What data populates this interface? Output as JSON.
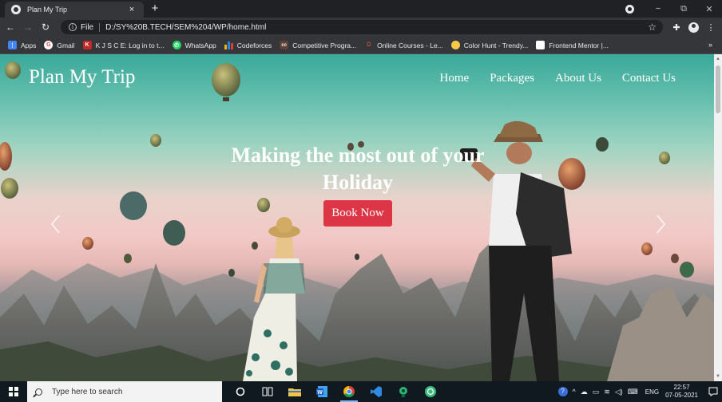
{
  "browser": {
    "tab": {
      "title": "Plan My Trip",
      "close_glyph": "×"
    },
    "new_tab_glyph": "+",
    "window_controls": {
      "minimize": "−",
      "restore": "⧉",
      "close": "✕"
    },
    "omnibox": {
      "scheme": "File",
      "url": "D:/SY%20B.TECH/SEM%204/WP/home.html"
    },
    "bookmarks": [
      {
        "label": "Apps",
        "icon": "apps-grid-icon",
        "color": "#4285f4"
      },
      {
        "label": "Gmail",
        "icon": "google-icon",
        "color": "#ea4335"
      },
      {
        "label": "K J S C E: Log in to t...",
        "icon": "kjsce-icon",
        "color": "#c62828"
      },
      {
        "label": "WhatsApp",
        "icon": "whatsapp-icon",
        "color": "#25d366"
      },
      {
        "label": "Codeforces",
        "icon": "codeforces-icon",
        "color": "#f2b200"
      },
      {
        "label": "Competitive Progra...",
        "icon": "cc-icon",
        "color": "#5d4037"
      },
      {
        "label": "Online Courses - Le...",
        "icon": "udemy-icon",
        "color": "#ec5252"
      },
      {
        "label": "Color Hunt - Trendy...",
        "icon": "colorhunt-icon",
        "color": "#f7c948"
      },
      {
        "label": "Frontend Mentor |...",
        "icon": "frontend-mentor-icon",
        "color": "#ffffff"
      }
    ],
    "bookmarks_more": "»"
  },
  "page": {
    "brand": "Plan My Trip",
    "nav": [
      "Home",
      "Packages",
      "About Us",
      "Contact Us"
    ],
    "hero_title": "Making the most out of your Holiday",
    "cta_label": "Book Now",
    "colors": {
      "cta": "#dc3545",
      "sky_top": "#3aa99a",
      "sky_mid": "#f2c8c6"
    }
  },
  "taskbar": {
    "search_placeholder": "Type here to search",
    "apps": [
      "cortana-icon",
      "task-view-icon",
      "file-explorer-icon",
      "word-icon",
      "chrome-icon",
      "vscode-icon",
      "maps-icon",
      "openai-icon"
    ],
    "language": "ENG",
    "time": "22:57",
    "date": "07-05-2021"
  }
}
